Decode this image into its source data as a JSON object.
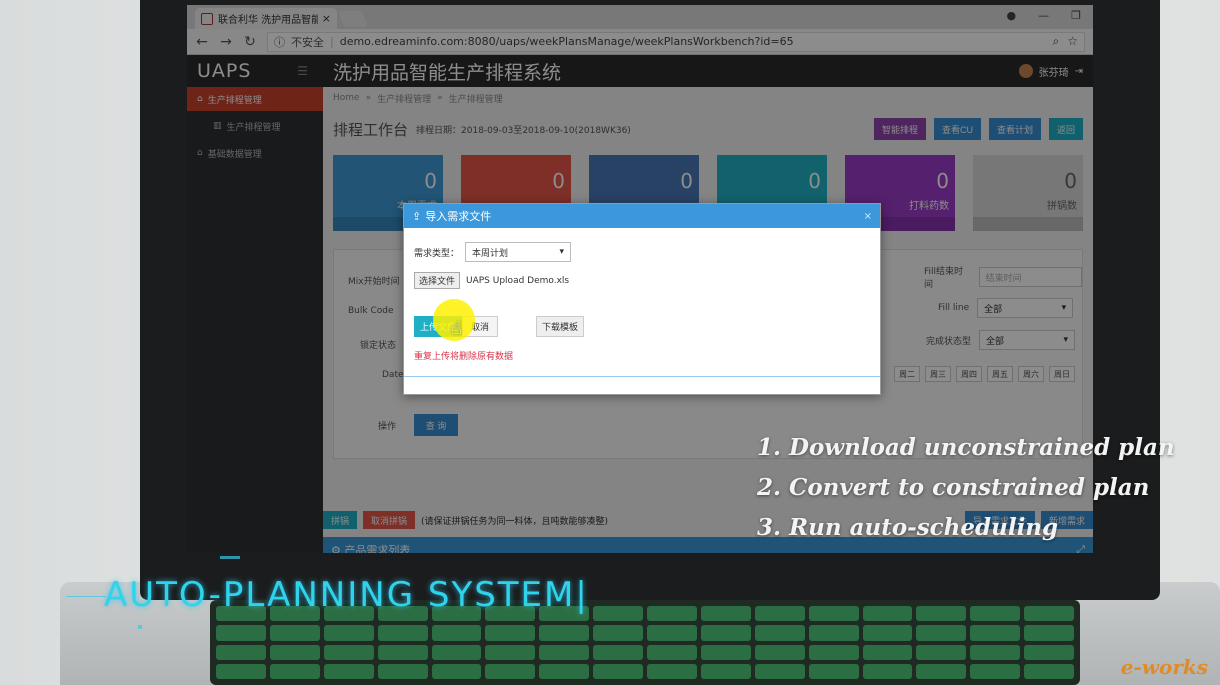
{
  "browser": {
    "tab_title": "联合利华 洗护用品智能生",
    "tab_close": "×",
    "security": "不安全",
    "url": "demo.edreaminfo.com:8080/uaps/weekPlansManage/weekPlansWorkbench?id=65"
  },
  "app": {
    "brand": "UAPS",
    "system_title": "洗护用品智能生产排程系统",
    "user_name": "张芬琦"
  },
  "sidebar": {
    "items": [
      {
        "label": "生产排程管理"
      },
      {
        "label": "生产排程管理"
      },
      {
        "label": "基础数据管理"
      }
    ]
  },
  "breadcrumb": [
    "Home",
    "生产排程管理",
    "生产排程管理"
  ],
  "workbench": {
    "title": "排程工作台",
    "date_range": "排程日期：2018-09-03至2018-09-10(2018WK36)",
    "buttons": [
      {
        "label": "智能排程",
        "color": "#8e44ad"
      },
      {
        "label": "查看CU",
        "color": "#3a8fd6"
      },
      {
        "label": "查看计划",
        "color": "#3a8fd6"
      },
      {
        "label": "返回",
        "color": "#1fb0c6"
      }
    ]
  },
  "cards": [
    {
      "value": "0",
      "label": "本周需求",
      "color": "#3c9ad6"
    },
    {
      "value": "0",
      "label": "",
      "color": "#e4574a"
    },
    {
      "value": "0",
      "label": "",
      "color": "#4a78b8"
    },
    {
      "value": "0",
      "label": "",
      "color": "#22b2c8"
    },
    {
      "value": "0",
      "label": "打料药数",
      "color": "#9b3bc7"
    },
    {
      "value": "0",
      "label": "拼锅数",
      "color": "#d9d9d9"
    }
  ],
  "filters": {
    "mix_start_label": "Mix开始时间",
    "bulk_code_label": "Bulk Code",
    "lock_status_label": "锁定状态",
    "date_label": "Date",
    "fill_end_label": "Fill结束时间",
    "fill_end_placeholder": "结束时间",
    "fill_line_label": "Fill line",
    "fill_line_value": "全部",
    "finish_status_label": "完成状态型",
    "finish_status_value": "全部",
    "days": [
      "周二",
      "周三",
      "周四",
      "周五",
      "周六",
      "周日"
    ],
    "action_label": "操作",
    "query_label": "查 询"
  },
  "bottom": {
    "btn1": "拼锅",
    "btn2": "取消拼锅",
    "note": "(请保证拼锅任务为同一料体，且吨数能够凑整)",
    "import_btn": "导入需求文件",
    "new_btn": "新增需求",
    "list_title": "产品需求列表"
  },
  "modal": {
    "title": "导入需求文件",
    "close": "×",
    "type_label": "需求类型：",
    "type_value": "本周计划",
    "choose_file": "选择文件",
    "file_name": "UAPS Upload Demo.xls",
    "upload": "上传文件",
    "cancel": "取消",
    "download_template": "下载模板",
    "warning": "重复上传将删除原有数据"
  },
  "overlay_text": {
    "steps": [
      "1. Download unconstrained plan",
      "2. Convert to constrained plan",
      "3. Run auto-scheduling"
    ],
    "auto_title": "AUTO-PLANNING SYSTEM|",
    "logo": "e-works"
  }
}
